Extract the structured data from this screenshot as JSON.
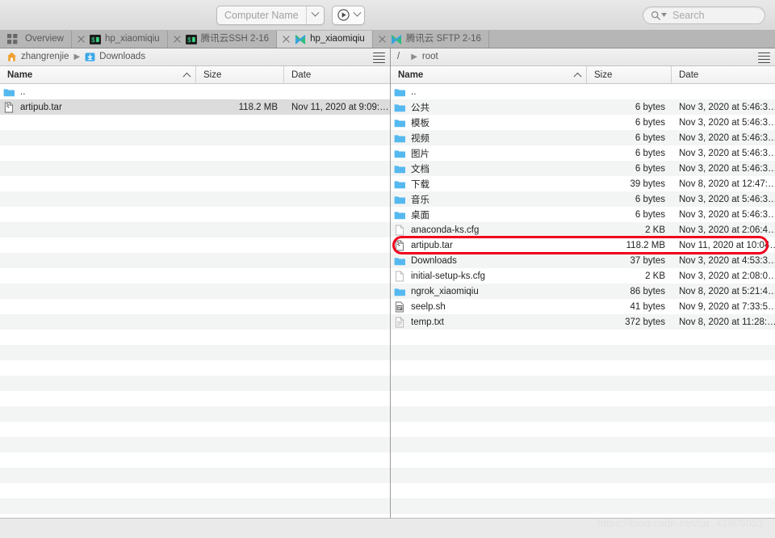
{
  "toolbar": {
    "computer_name_value": "",
    "computer_name_placeholder": "Computer Name",
    "computer_name_dropdown_icon": "chevron-down-icon",
    "play_button_icon": "play-circle-icon",
    "play_dropdown_icon": "chevron-down-icon",
    "search_value": "",
    "search_placeholder": "Search",
    "search_icon": "search-icon"
  },
  "tabs": [
    {
      "label": "Overview",
      "icon": "grid-icon",
      "closable": false,
      "active": false
    },
    {
      "label": "hp_xiaomiqiu",
      "icon": "terminal-icon",
      "closable": true,
      "active": false
    },
    {
      "label": "腾讯云SSH 2-16",
      "icon": "terminal-icon",
      "closable": true,
      "active": false
    },
    {
      "label": "hp_xiaomiqiu",
      "icon": "sftp-icon",
      "closable": true,
      "active": true
    },
    {
      "label": "腾讯云 SFTP 2-16",
      "icon": "sftp-icon",
      "closable": true,
      "active": false
    }
  ],
  "left_pane": {
    "breadcrumb": [
      {
        "label": "zhangrenjie",
        "icon": "home-icon"
      },
      {
        "label": "Downloads",
        "icon": "downloads-folder-icon"
      }
    ],
    "menu_icon": "hamburger-menu-icon",
    "columns": [
      {
        "key": "name",
        "label": "Name",
        "sorted": true,
        "sort_dir": "asc"
      },
      {
        "key": "size",
        "label": "Size"
      },
      {
        "key": "date",
        "label": "Date"
      }
    ],
    "rows": [
      {
        "name": "..",
        "icon": "folder-icon",
        "size": "",
        "date": "",
        "selected": false
      },
      {
        "name": "artipub.tar",
        "icon": "archive-file-icon",
        "size": "118.2 MB",
        "date": "Nov 11, 2020 at 9:09:…",
        "selected": true
      }
    ],
    "empty_row_count": 26
  },
  "right_pane": {
    "breadcrumb": [
      {
        "label": "/",
        "icon": ""
      },
      {
        "label": "root",
        "icon": ""
      }
    ],
    "menu_icon": "hamburger-menu-icon",
    "columns": [
      {
        "key": "name",
        "label": "Name",
        "sorted": true,
        "sort_dir": "asc"
      },
      {
        "key": "size",
        "label": "Size"
      },
      {
        "key": "date",
        "label": "Date"
      }
    ],
    "rows": [
      {
        "name": "..",
        "icon": "folder-icon",
        "size": "",
        "date": "",
        "highlighted": false
      },
      {
        "name": "公共",
        "icon": "folder-icon",
        "size": "6 bytes",
        "date": "Nov 3, 2020 at 5:46:3…",
        "highlighted": false
      },
      {
        "name": "模板",
        "icon": "folder-icon",
        "size": "6 bytes",
        "date": "Nov 3, 2020 at 5:46:3…",
        "highlighted": false
      },
      {
        "name": "视频",
        "icon": "folder-icon",
        "size": "6 bytes",
        "date": "Nov 3, 2020 at 5:46:3…",
        "highlighted": false
      },
      {
        "name": "图片",
        "icon": "folder-icon",
        "size": "6 bytes",
        "date": "Nov 3, 2020 at 5:46:3…",
        "highlighted": false
      },
      {
        "name": "文档",
        "icon": "folder-icon",
        "size": "6 bytes",
        "date": "Nov 3, 2020 at 5:46:3…",
        "highlighted": false
      },
      {
        "name": "下载",
        "icon": "folder-icon",
        "size": "39 bytes",
        "date": "Nov 8, 2020 at 12:47:…",
        "highlighted": false
      },
      {
        "name": "音乐",
        "icon": "folder-icon",
        "size": "6 bytes",
        "date": "Nov 3, 2020 at 5:46:3…",
        "highlighted": false
      },
      {
        "name": "桌面",
        "icon": "folder-icon",
        "size": "6 bytes",
        "date": "Nov 3, 2020 at 5:46:3…",
        "highlighted": false
      },
      {
        "name": "anaconda-ks.cfg",
        "icon": "blank-file-icon",
        "size": "2 KB",
        "date": "Nov 3, 2020 at 2:06:4…",
        "highlighted": false
      },
      {
        "name": "artipub.tar",
        "icon": "archive-file-icon",
        "size": "118.2 MB",
        "date": "Nov 11, 2020 at 10:04…",
        "highlighted": true
      },
      {
        "name": "Downloads",
        "icon": "folder-icon",
        "size": "37 bytes",
        "date": "Nov 3, 2020 at 4:53:3…",
        "highlighted": false
      },
      {
        "name": "initial-setup-ks.cfg",
        "icon": "blank-file-icon",
        "size": "2 KB",
        "date": "Nov 3, 2020 at 2:08:0…",
        "highlighted": false
      },
      {
        "name": "ngrok_xiaomiqiu",
        "icon": "folder-icon",
        "size": "86 bytes",
        "date": "Nov 8, 2020 at 5:21:4…",
        "highlighted": false
      },
      {
        "name": "seelp.sh",
        "icon": "script-file-icon",
        "size": "41 bytes",
        "date": "Nov 9, 2020 at 7:33:5…",
        "highlighted": false
      },
      {
        "name": "temp.txt",
        "icon": "text-file-icon",
        "size": "372 bytes",
        "date": "Nov 8, 2020 at 11:28:…",
        "highlighted": false
      }
    ],
    "empty_row_count": 12
  },
  "watermark": "https://blog.csdn.net/qq_42909053",
  "colors": {
    "folder_blue": "#55b9f0",
    "highlight_red": "#f2001e",
    "selection_gray": "#dcdcdc",
    "tab_active": "#d3d3d3",
    "tab_bar": "#b6b6b6"
  }
}
